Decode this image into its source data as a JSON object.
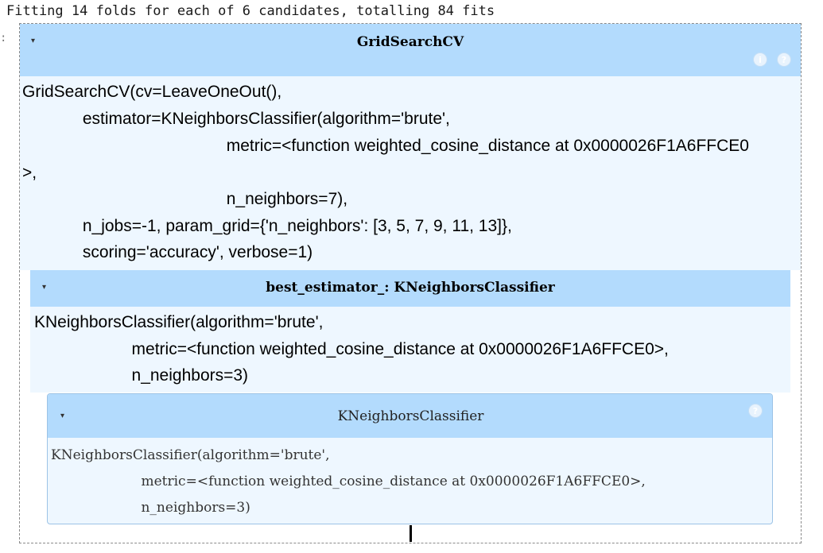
{
  "stdout": {
    "text": "Fitting 14 folds for each of 6 candidates, totalling 84 fits",
    "margin_marker": ":"
  },
  "gridsearch": {
    "title": "GridSearchCV",
    "toggle": "▾",
    "icons": [
      "info-icon",
      "help-icon"
    ],
    "icon_glyphs": [
      "i",
      "?"
    ],
    "code_lines": [
      "GridSearchCV(cv=LeaveOneOut(),",
      "             estimator=KNeighborsClassifier(algorithm='brute',",
      "                                            metric=<function weighted_cosine_distance at 0x0000026F1A6FFCE0",
      ">,",
      "                                            n_neighbors=7),",
      "             n_jobs=-1, param_grid={'n_neighbors': [3, 5, 7, 9, 11, 13]},",
      "             scoring='accuracy', verbose=1)"
    ]
  },
  "best_estimator": {
    "title": "best_estimator_: KNeighborsClassifier",
    "toggle": "▾",
    "code_lines": [
      "KNeighborsClassifier(algorithm='brute',",
      "                     metric=<function weighted_cosine_distance at 0x0000026F1A6FFCE0>,",
      "                     n_neighbors=3)"
    ]
  },
  "knn": {
    "title": "KNeighborsClassifier",
    "toggle": "▾",
    "icons": [
      "help-icon"
    ],
    "icon_glyphs": [
      "?"
    ],
    "code_lines": [
      "KNeighborsClassifier(algorithm='brute',",
      "                     metric=<function weighted_cosine_distance at 0x0000026F1A6FFCE0>,",
      "                     n_neighbors=3)"
    ]
  },
  "colors": {
    "header_bg": "#b3dbfd",
    "body_bg": "#eef7ff",
    "border": "#9cc3e6"
  }
}
